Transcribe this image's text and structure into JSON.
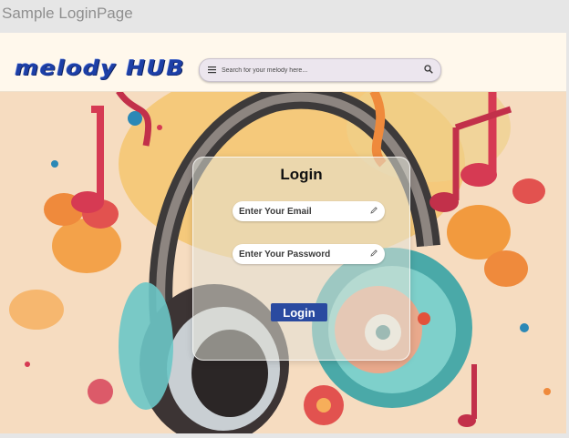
{
  "window": {
    "title": "Sample LoginPage"
  },
  "navbar": {
    "brand": "melody HUB",
    "search": {
      "placeholder": "Search for your melody here...",
      "menu_icon": "menu-icon",
      "search_icon": "search-icon"
    }
  },
  "login": {
    "title": "Login",
    "email_placeholder": "Enter Your Email",
    "password_placeholder": "Enter Your Password",
    "edit_icon": "pencil-icon",
    "button_label": "Login"
  },
  "colors": {
    "navbar_bg": "#fff8ec",
    "brand": "#1d3fa6",
    "button_bg": "#2a4aa0",
    "page_bg": "#f6dcc0"
  }
}
